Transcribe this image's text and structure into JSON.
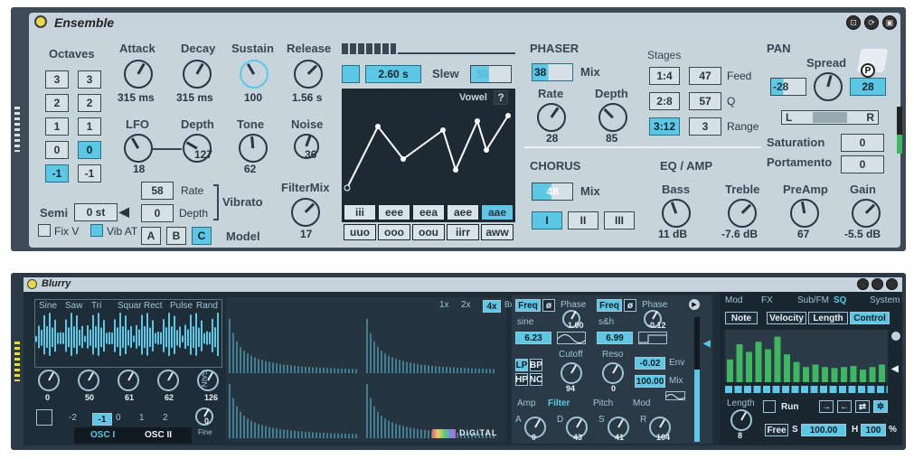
{
  "ensemble": {
    "title": "Ensemble",
    "octaves_label": "Octaves",
    "octave_left": [
      "3",
      "2",
      "1",
      "0",
      "-1"
    ],
    "octave_right": [
      "3",
      "2",
      "1",
      "0",
      "-1"
    ],
    "semi_label": "Semi",
    "semi_value": "0 st",
    "fixv_label": "Fix V",
    "vibat_label": "Vib AT",
    "knobs": {
      "attack": {
        "label": "Attack",
        "value": "315 ms"
      },
      "decay": {
        "label": "Decay",
        "value": "315 ms"
      },
      "sustain": {
        "label": "Sustain",
        "value": "100"
      },
      "release": {
        "label": "Release",
        "value": "1.56 s"
      },
      "lfo": {
        "label": "LFO",
        "value": "18"
      },
      "depth": {
        "label": "Depth",
        "value": "127"
      },
      "tone": {
        "label": "Tone",
        "value": "62"
      },
      "noise": {
        "label": "Noise",
        "value": "36"
      },
      "filtermix": {
        "label": "FilterMix",
        "value": "17"
      }
    },
    "vibrato": {
      "rate_value": "58",
      "rate_label": "Rate",
      "depth_value": "0",
      "depth_label": "Depth",
      "label": "Vibrato"
    },
    "model": {
      "buttons": [
        "A",
        "B",
        "C"
      ],
      "label": "Model"
    },
    "time_value": "2.60 s",
    "slew_label": "Slew",
    "slew_value": "59",
    "vowel_label": "Vowel",
    "vowel_help": "?",
    "vowels_row1": [
      "iii",
      "eee",
      "eea",
      "aee",
      "aae"
    ],
    "vowels_row2": [
      "uuo",
      "ooo",
      "oou",
      "iirr",
      "aww"
    ],
    "phaser": {
      "title": "PHASER",
      "value": "38",
      "mix_label": "Mix",
      "rate_label": "Rate",
      "rate_value": "28",
      "depth_label": "Depth",
      "depth_value": "85"
    },
    "stages": {
      "label": "Stages",
      "values": [
        "1:4",
        "2:8",
        "3:12"
      ],
      "params": [
        {
          "value": "47",
          "label": "Feed"
        },
        {
          "value": "57",
          "label": "Q"
        },
        {
          "value": "3",
          "label": "Range"
        }
      ]
    },
    "pan": {
      "title": "PAN",
      "spread_label": "Spread",
      "left_value": "-28",
      "right_value": "28",
      "l": "L",
      "r": "R",
      "p": "P"
    },
    "saturation": {
      "label": "Saturation",
      "value": "0"
    },
    "portamento": {
      "label": "Portamento",
      "value": "0"
    },
    "chorus": {
      "title": "CHORUS",
      "value": "48",
      "mix_label": "Mix",
      "modes": [
        "I",
        "II",
        "III"
      ]
    },
    "eq": {
      "title": "EQ / AMP",
      "bass_label": "Bass",
      "bass_value": "11 dB",
      "treble_label": "Treble",
      "treble_value": "-7.6 dB",
      "preamp_label": "PreAmp",
      "preamp_value": "67",
      "gain_label": "Gain",
      "gain_value": "-5.5 dB"
    }
  },
  "blurry": {
    "title": "Blurry",
    "waves": [
      "Sine",
      "Saw",
      "Tri",
      "Squar",
      "Rect",
      "Pulse",
      "Rand"
    ],
    "osc_knob_values": [
      "0",
      "50",
      "61",
      "62",
      "126"
    ],
    "gain_label": "G A I N",
    "offsets": [
      "-2",
      "-1",
      "0",
      "1",
      "2"
    ],
    "fine_label": "Fine",
    "fine_value": "0",
    "osc_tabs": [
      "OSC I",
      "OSC II"
    ],
    "zoom": [
      "1x",
      "2x",
      "4x",
      "8x"
    ],
    "digital_label": "DiGiTAL",
    "lfo1": {
      "freq": "Freq",
      "phase_label": "Phase",
      "wave": "sine",
      "phase_value": "1.00",
      "rate": "6.23"
    },
    "lfo2": {
      "freq": "Freq",
      "phase_label": "Phase",
      "wave": "s&h",
      "phase_value": "-0.12",
      "rate": "6.99"
    },
    "filter": {
      "types": [
        "LP",
        "BP",
        "HP",
        "NC"
      ],
      "cutoff_label": "Cutoff",
      "cutoff_value": "94",
      "reso_label": "Reso",
      "reso_value": "0",
      "env_value": "-0.02",
      "env_label": "Env",
      "mix_value": "100.00",
      "mix_label": "Mix"
    },
    "lower_tabs": [
      "Amp",
      "Filter",
      "Pitch",
      "Mod"
    ],
    "adsr": [
      {
        "label": "A",
        "value": "0"
      },
      {
        "label": "D",
        "value": "43"
      },
      {
        "label": "S",
        "value": "41"
      },
      {
        "label": "R",
        "value": "104"
      }
    ],
    "seq_tabs": [
      "Mod",
      "FX",
      "Sub/FM",
      "SQ",
      "System"
    ],
    "seq_subtabs": [
      "Note",
      "Velocity",
      "Length",
      "Control"
    ],
    "seq_bars": [
      0.45,
      0.75,
      0.6,
      0.8,
      0.65,
      0.9,
      0.55,
      0.4,
      0.3,
      0.35,
      0.3,
      0.28,
      0.3,
      0.32,
      0.25,
      0.3,
      0.35
    ],
    "length_label": "Length",
    "length_value": "8",
    "run_label": "Run",
    "free_label": "Free",
    "s_label": "S",
    "s_value": "100.00",
    "h_label": "H",
    "h_value": "100",
    "percent": "%"
  }
}
